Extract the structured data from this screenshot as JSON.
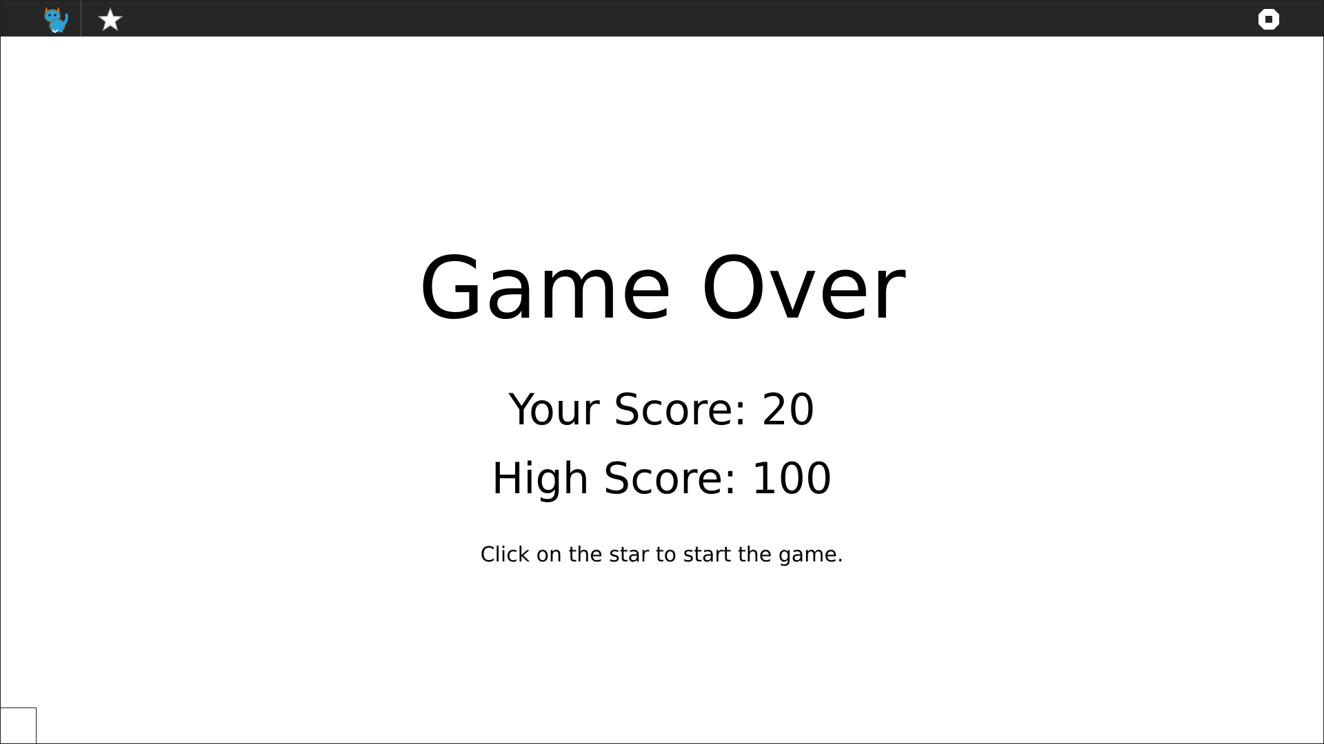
{
  "toolbar": {
    "avatar_icon": "cat-sprite-icon",
    "star_icon": "star-icon",
    "stop_icon": "stop-icon"
  },
  "game": {
    "title": "Game Over",
    "your_score": "Your Score: 20",
    "high_score": "High Score: 100",
    "hint": "Click on the star to start the game."
  },
  "colors": {
    "toolbar_bg": "#262626",
    "stage_bg": "#ffffff",
    "text": "#000000"
  }
}
